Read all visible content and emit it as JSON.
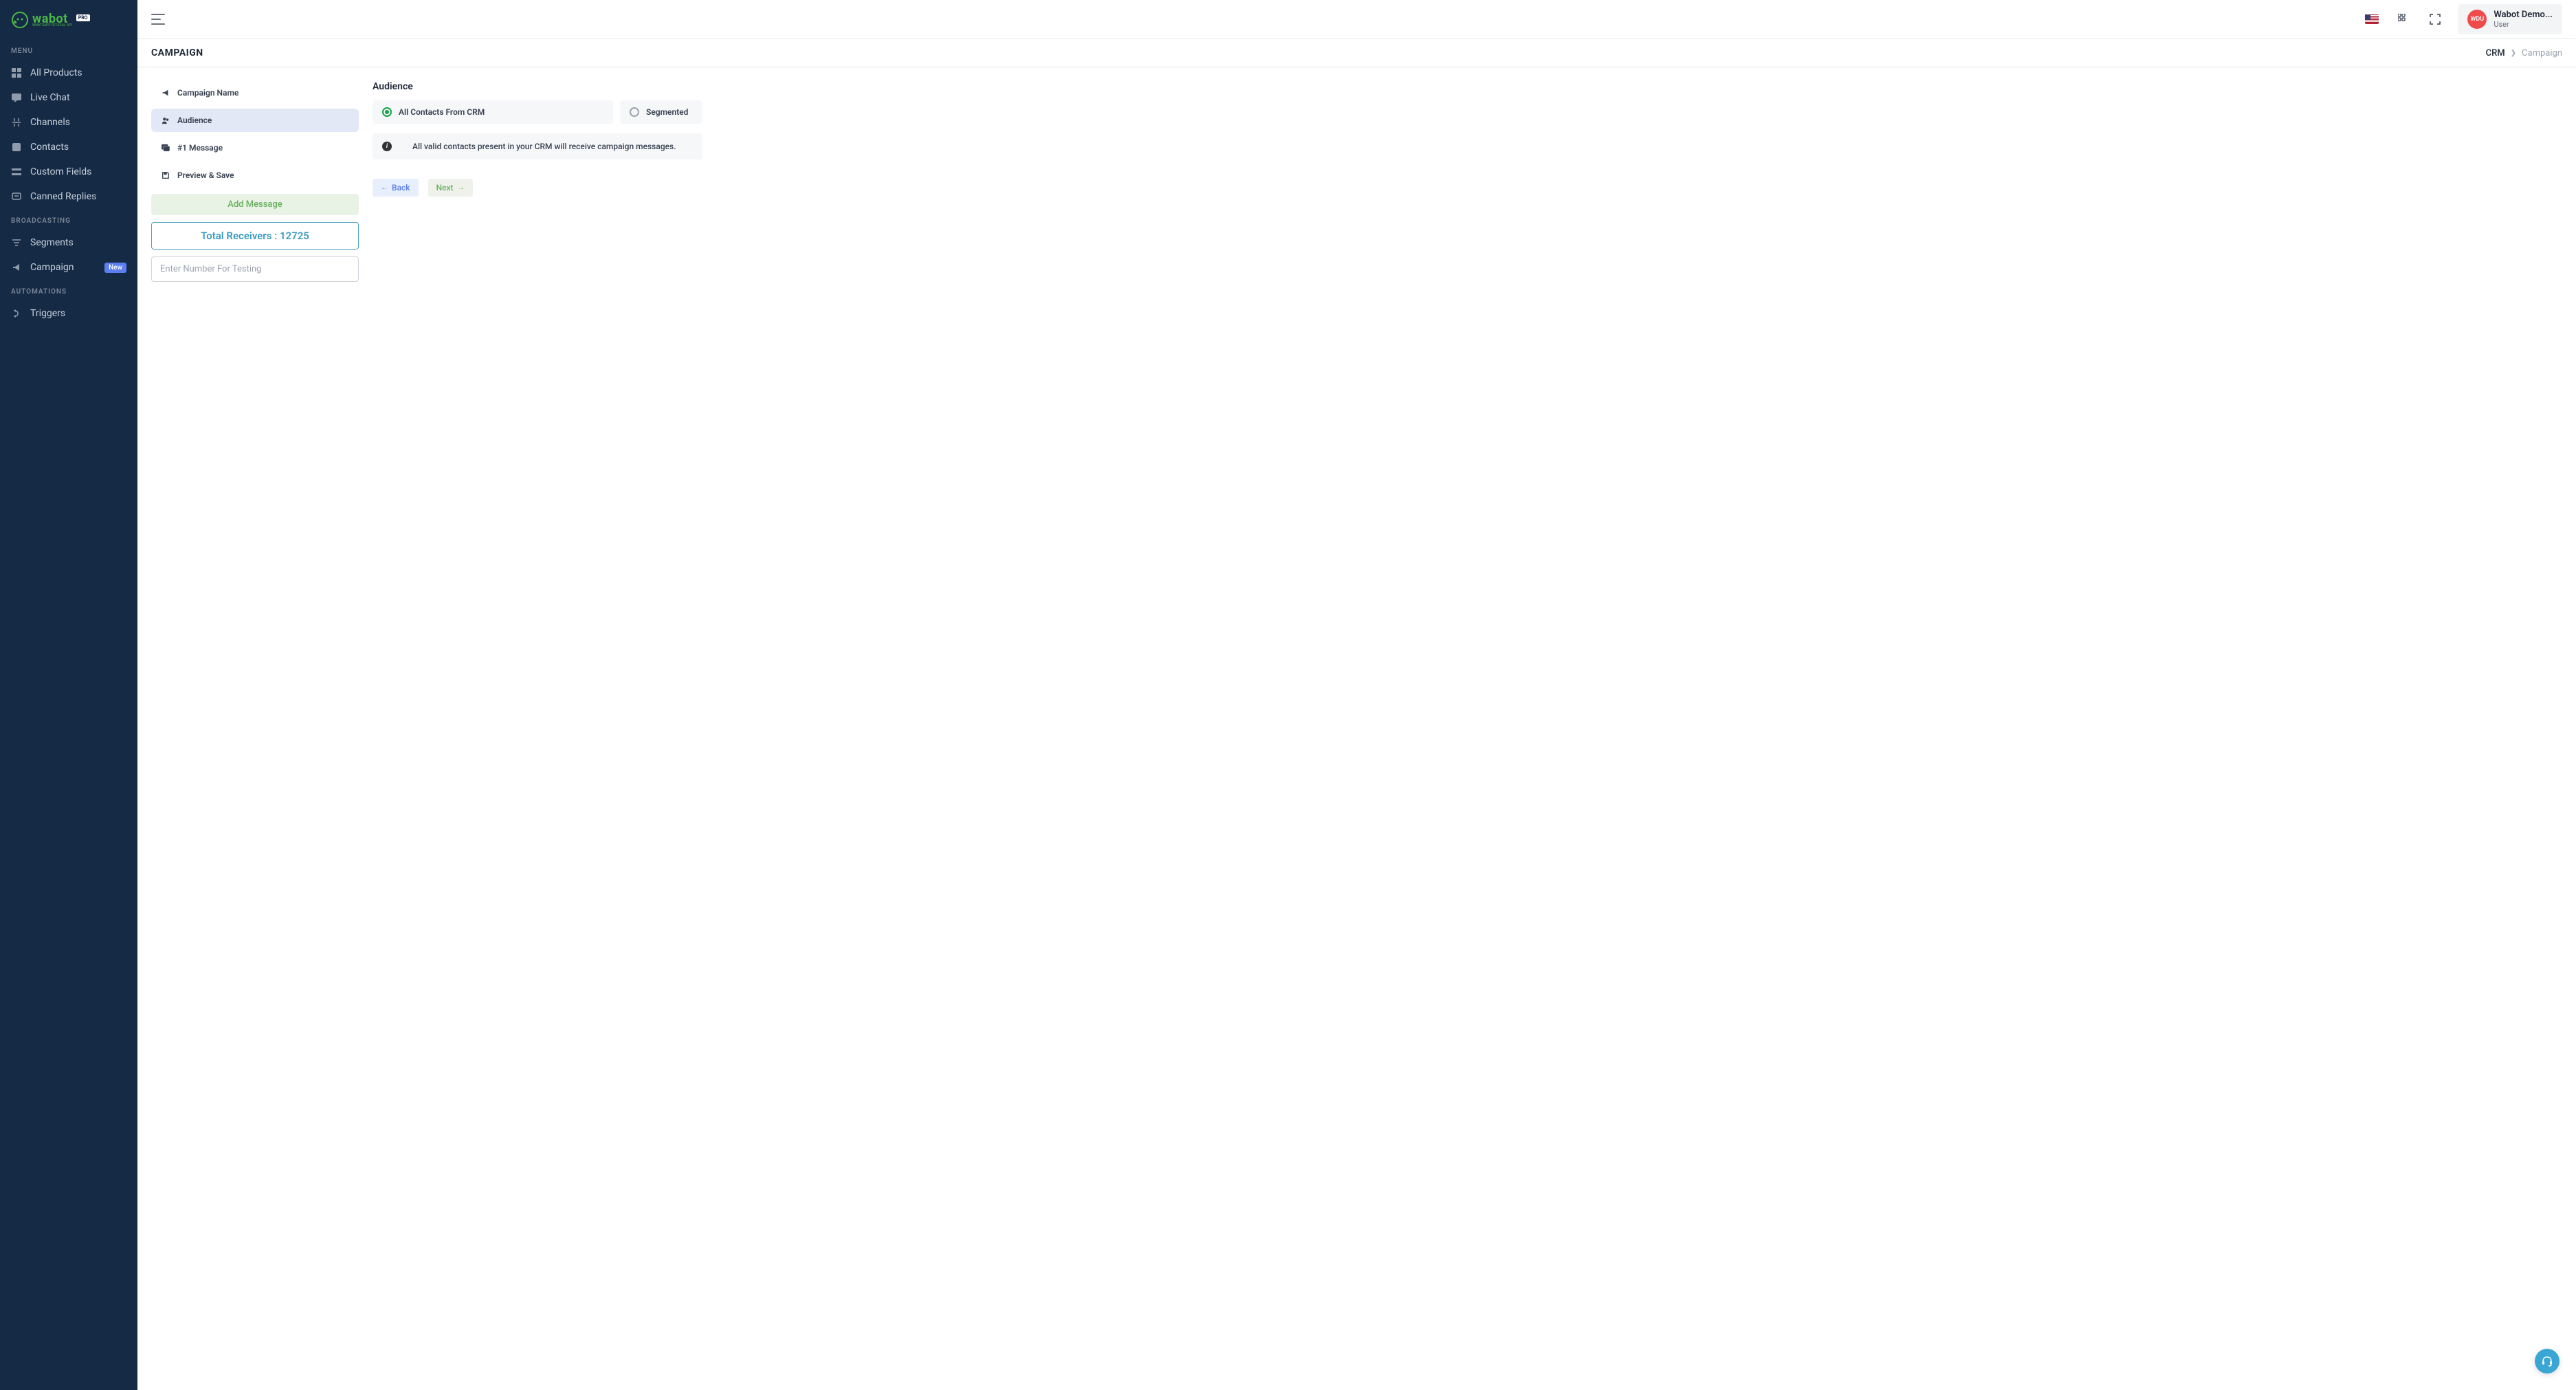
{
  "logo": {
    "text": "wabot",
    "sub": "WHATSAPP OFFICIAL API",
    "pro": "PRO"
  },
  "sidebar": {
    "sections": [
      {
        "title": "MENU",
        "items": [
          {
            "icon": "grid",
            "label": "All Products"
          },
          {
            "icon": "chat",
            "label": "Live Chat"
          },
          {
            "icon": "channels",
            "label": "Channels"
          },
          {
            "icon": "contacts",
            "label": "Contacts"
          },
          {
            "icon": "fields",
            "label": "Custom Fields"
          },
          {
            "icon": "canned",
            "label": "Canned Replies"
          }
        ]
      },
      {
        "title": "BROADCASTING",
        "items": [
          {
            "icon": "segments",
            "label": "Segments"
          },
          {
            "icon": "campaign",
            "label": "Campaign",
            "badge": "New"
          }
        ]
      },
      {
        "title": "AUTOMATIONS",
        "items": [
          {
            "icon": "triggers",
            "label": "Triggers"
          }
        ]
      }
    ]
  },
  "header": {
    "user_initials": "WDU",
    "user_name": "Wabot Demo...",
    "user_role": "User"
  },
  "breadcrumb": {
    "page_title": "CAMPAIGN",
    "root": "CRM",
    "current": "Campaign"
  },
  "steps": [
    {
      "icon": "megaphone",
      "label": "Campaign Name",
      "active": false
    },
    {
      "icon": "audience",
      "label": "Audience",
      "active": true
    },
    {
      "icon": "message",
      "label": "#1 Message",
      "active": false
    },
    {
      "icon": "save",
      "label": "Preview & Save",
      "active": false
    }
  ],
  "steps_panel": {
    "add_message": "Add Message",
    "total_receivers_label": "Total Receivers :",
    "total_receivers_count": "12725",
    "test_placeholder": "Enter Number For Testing"
  },
  "right": {
    "title": "Audience",
    "options": [
      {
        "label": "All Contacts From CRM",
        "checked": true
      },
      {
        "label": "Segmented",
        "checked": false
      }
    ],
    "info": "All valid contacts present in your CRM will receive campaign messages.",
    "back": "Back",
    "next": "Next"
  }
}
